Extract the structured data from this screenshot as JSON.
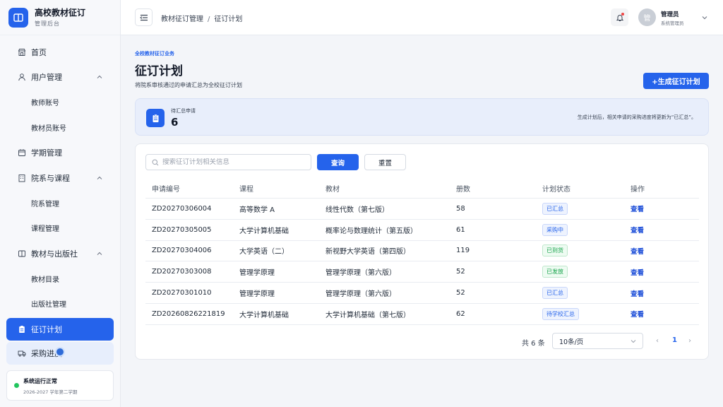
{
  "brand": {
    "title": "高校教材征订",
    "subtitle": "管理后台"
  },
  "sidebar": {
    "items": [
      {
        "label": "首页",
        "icon": "storefront-icon"
      },
      {
        "label": "用户管理",
        "icon": "user-icon",
        "expanded": true
      },
      {
        "label": "教师账号",
        "sub": true
      },
      {
        "label": "教材员账号",
        "sub": true
      },
      {
        "label": "学期管理",
        "icon": "calendar-icon"
      },
      {
        "label": "院系与课程",
        "icon": "building-icon",
        "expanded": true
      },
      {
        "label": "院系管理",
        "sub": true
      },
      {
        "label": "课程管理",
        "sub": true
      },
      {
        "label": "教材与出版社",
        "icon": "book-icon",
        "expanded": true
      },
      {
        "label": "教材目录",
        "sub": true
      },
      {
        "label": "出版社管理",
        "sub": true
      },
      {
        "label": "征订计划",
        "icon": "clipboard-icon",
        "active": true
      },
      {
        "label": "采购进度",
        "icon": "truck-icon"
      }
    ],
    "status": {
      "title": "系统运行正常",
      "subtitle": "2026-2027 学年第二学期",
      "color": "#22c55e"
    }
  },
  "topbar": {
    "breadcrumb": [
      "教材征订管理",
      "征订计划"
    ],
    "user": {
      "avatar": "管",
      "name": "管理员",
      "role": "系统管理员"
    }
  },
  "main": {
    "eyebrow": "全校教材征订业务",
    "title": "征订计划",
    "description": "将院系审核通过的申请汇总为全校征订计划",
    "generate_button": "+生成征订计划",
    "summary": {
      "label": "待汇总申请",
      "count": "6",
      "note": "生成计划后，相关申请的采购进度将更新为“已汇总”。"
    },
    "search": {
      "placeholder": "搜索征订计划相关信息",
      "query_button": "查询",
      "reset_button": "重置"
    },
    "table": {
      "columns": [
        "申请编号",
        "课程",
        "教材",
        "册数",
        "计划状态",
        "操作"
      ],
      "rows": [
        {
          "id": "ZD20270306004",
          "course": "高等数学 A",
          "textbook": "线性代数（第七版）",
          "qty": "58",
          "status": "已汇总",
          "status_color": "#2563eb",
          "action": "查看"
        },
        {
          "id": "ZD20270305005",
          "course": "大学计算机基础",
          "textbook": "概率论与数理统计（第五版）",
          "qty": "61",
          "status": "采购中",
          "status_color": "#2563eb",
          "action": "查看"
        },
        {
          "id": "ZD20270304006",
          "course": "大学英语（二）",
          "textbook": "新视野大学英语（第四版）",
          "qty": "119",
          "status": "已到货",
          "status_color": "#16a34a",
          "action": "查看"
        },
        {
          "id": "ZD20270303008",
          "course": "管理学原理",
          "textbook": "管理学原理（第六版）",
          "qty": "52",
          "status": "已发放",
          "status_color": "#16a34a",
          "action": "查看"
        },
        {
          "id": "ZD20270301010",
          "course": "管理学原理",
          "textbook": "管理学原理（第六版）",
          "qty": "52",
          "status": "已汇总",
          "status_color": "#2563eb",
          "action": "查看"
        },
        {
          "id": "ZD20260826221819",
          "course": "大学计算机基础",
          "textbook": "大学计算机基础（第七版）",
          "qty": "62",
          "status": "待学校汇总",
          "status_color": "#2563eb",
          "action": "查看"
        }
      ]
    },
    "pagination": {
      "total": "共 6 条",
      "page_size": "10条/页",
      "current": "1",
      "prev": "‹",
      "next": "›"
    }
  },
  "colors": {
    "accent": "#2563eb",
    "success": "#16a34a"
  }
}
